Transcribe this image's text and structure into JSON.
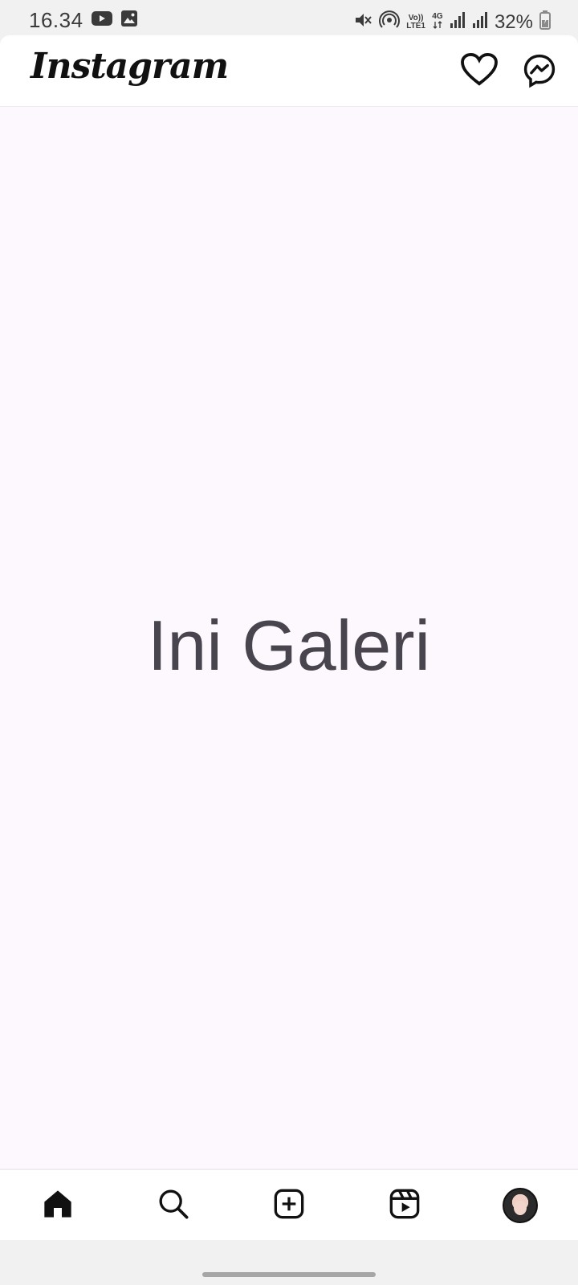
{
  "status_bar": {
    "time": "16.34",
    "battery": "32%",
    "volte_label": "Vo))\nLTE1",
    "network_label": "4G"
  },
  "header": {
    "logo": "Instagram",
    "actions": [
      {
        "name": "heart-icon",
        "label": "Notifications"
      },
      {
        "name": "messenger-icon",
        "label": "Messages"
      }
    ]
  },
  "main": {
    "title": "Ini Galeri"
  },
  "bottom_nav": {
    "items": [
      {
        "name": "nav-home",
        "icon": "home-icon"
      },
      {
        "name": "nav-search",
        "icon": "search-icon"
      },
      {
        "name": "nav-create",
        "icon": "plus-square-icon"
      },
      {
        "name": "nav-reels",
        "icon": "reels-icon"
      },
      {
        "name": "nav-profile",
        "icon": "avatar"
      }
    ]
  },
  "colors": {
    "main_bg": "#fdf8fd",
    "title_text": "#49454f",
    "system_bar_bg": "#f1f1f1",
    "header_bg": "#ffffff"
  }
}
